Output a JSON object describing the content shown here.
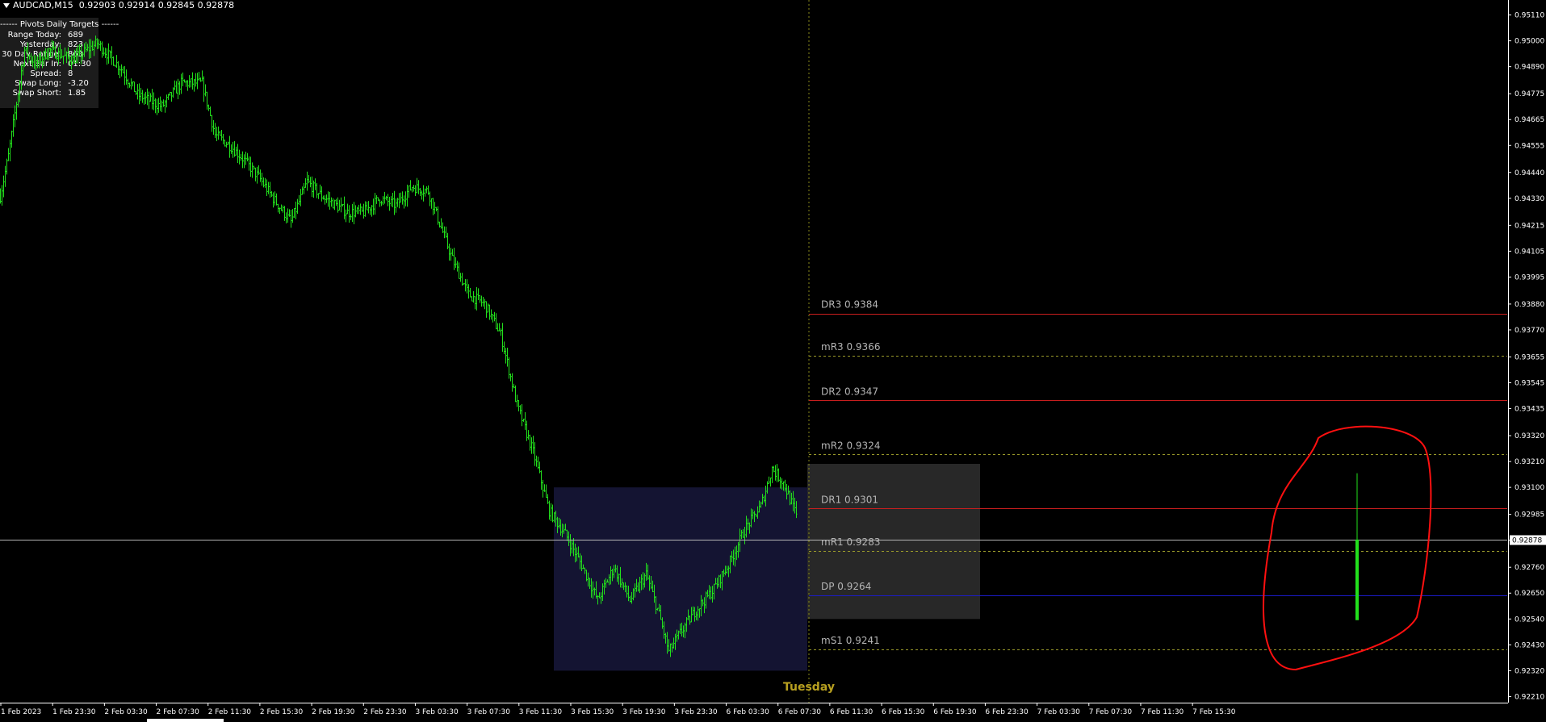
{
  "header": {
    "symbol": "AUDCAD,M15",
    "ohlc": "0.92903 0.92914 0.92845 0.92878"
  },
  "info_panel": {
    "title": "------ Pivots Daily Targets ------",
    "rows": [
      {
        "label": "Range Today:",
        "value": "689"
      },
      {
        "label": "Yesterday:",
        "value": "823"
      },
      {
        "label": "30 Day Range:",
        "value": "863"
      },
      {
        "label": "Next Bar In:",
        "value": "01:30"
      },
      {
        "label": "Spread:",
        "value": "8"
      },
      {
        "label": "Swap Long:",
        "value": "-3.20"
      },
      {
        "label": "Swap Short:",
        "value": "1.85"
      }
    ]
  },
  "colors": {
    "background": "#000000",
    "bars": "#22e01c",
    "daily_pivot_line": "#c81e1e",
    "mid_pivot_line": "#9a9a2a",
    "dp_line": "#1c1cc8",
    "bid_line": "#b4b4b4",
    "day_separator": "#8a8a1a",
    "prev_day_box": "#141432",
    "today_box": "#282828",
    "annotation": "#ff1010",
    "day_label": "#b8a020",
    "axis_text": "#ffffff",
    "pivot_text": "#b4b4b4"
  },
  "chart_data": {
    "type": "ohlc",
    "symbol": "AUDCAD",
    "timeframe": "M15",
    "ylim": [
      0.9216,
      0.9516
    ],
    "price_axis_ticks": [
      "0.95110",
      "0.95000",
      "0.94890",
      "0.94775",
      "0.94665",
      "0.94555",
      "0.94440",
      "0.94330",
      "0.94215",
      "0.94105",
      "0.93995",
      "0.93880",
      "0.93770",
      "0.93655",
      "0.93545",
      "0.93435",
      "0.93320",
      "0.93210",
      "0.93100",
      "0.92985",
      "0.92875",
      "0.92760",
      "0.92650",
      "0.92540",
      "0.92430",
      "0.92320",
      "0.92210"
    ],
    "current_price": "0.92878",
    "time_axis_labels": [
      "1 Feb 2023",
      "1 Feb 23:30",
      "2 Feb 03:30",
      "2 Feb 07:30",
      "2 Feb 11:30",
      "2 Feb 15:30",
      "2 Feb 19:30",
      "2 Feb 23:30",
      "3 Feb 03:30",
      "3 Feb 07:30",
      "3 Feb 11:30",
      "3 Feb 15:30",
      "3 Feb 19:30",
      "3 Feb 23:30",
      "6 Feb 03:30",
      "6 Feb 07:30",
      "6 Feb 11:30",
      "6 Feb 15:30",
      "6 Feb 19:30",
      "6 Feb 23:30",
      "7 Feb 03:30",
      "7 Feb 07:30",
      "7 Feb 11:30",
      "7 Feb 15:30"
    ],
    "day_label": "Tuesday",
    "pivot_levels": [
      {
        "name": "DR3",
        "value": "0.9384",
        "kind": "daily"
      },
      {
        "name": "mR3",
        "value": "0.9366",
        "kind": "mid"
      },
      {
        "name": "DR2",
        "value": "0.9347",
        "kind": "daily"
      },
      {
        "name": "mR2",
        "value": "0.9324",
        "kind": "mid"
      },
      {
        "name": "DR1",
        "value": "0.9301",
        "kind": "daily"
      },
      {
        "name": "mR1",
        "value": "0.9283",
        "kind": "mid"
      },
      {
        "name": "DP",
        "value": "0.9264",
        "kind": "dp"
      },
      {
        "name": "mS1",
        "value": "0.9241",
        "kind": "mid"
      }
    ],
    "price_path": [
      [
        0,
        0.9434
      ],
      [
        5,
        0.9451
      ],
      [
        15,
        0.9496
      ],
      [
        22,
        0.949
      ],
      [
        30,
        0.9496
      ],
      [
        45,
        0.9492
      ],
      [
        60,
        0.9499
      ],
      [
        75,
        0.9488
      ],
      [
        85,
        0.9477
      ],
      [
        100,
        0.9472
      ],
      [
        112,
        0.9482
      ],
      [
        125,
        0.9482
      ],
      [
        133,
        0.946
      ],
      [
        143,
        0.9455
      ],
      [
        150,
        0.945
      ],
      [
        160,
        0.9442
      ],
      [
        170,
        0.9432
      ],
      [
        180,
        0.9423
      ],
      [
        190,
        0.944
      ],
      [
        199,
        0.9434
      ],
      [
        208,
        0.943
      ],
      [
        215,
        0.9427
      ],
      [
        225,
        0.9427
      ],
      [
        235,
        0.9433
      ],
      [
        245,
        0.943
      ],
      [
        255,
        0.9438
      ],
      [
        265,
        0.9436
      ],
      [
        280,
        0.9407
      ],
      [
        290,
        0.9392
      ],
      [
        300,
        0.9388
      ],
      [
        310,
        0.9375
      ],
      [
        320,
        0.9345
      ],
      [
        330,
        0.9325
      ],
      [
        340,
        0.93
      ],
      [
        350,
        0.929
      ],
      [
        360,
        0.9277
      ],
      [
        370,
        0.9262
      ],
      [
        380,
        0.9276
      ],
      [
        390,
        0.9262
      ],
      [
        400,
        0.9273
      ],
      [
        408,
        0.9256
      ],
      [
        414,
        0.924
      ],
      [
        421,
        0.9248
      ],
      [
        431,
        0.9258
      ],
      [
        441,
        0.9266
      ],
      [
        451,
        0.9277
      ],
      [
        461,
        0.9292
      ],
      [
        471,
        0.9302
      ],
      [
        478,
        0.9318
      ],
      [
        485,
        0.9312
      ],
      [
        493,
        0.9298
      ]
    ],
    "prev_day_box": {
      "from_index": 343,
      "to_index": 500,
      "high": 0.931,
      "low": 0.9232
    },
    "today_box": {
      "from_index": 500,
      "to_index": 607,
      "high": 0.932,
      "low": 0.9254
    }
  }
}
